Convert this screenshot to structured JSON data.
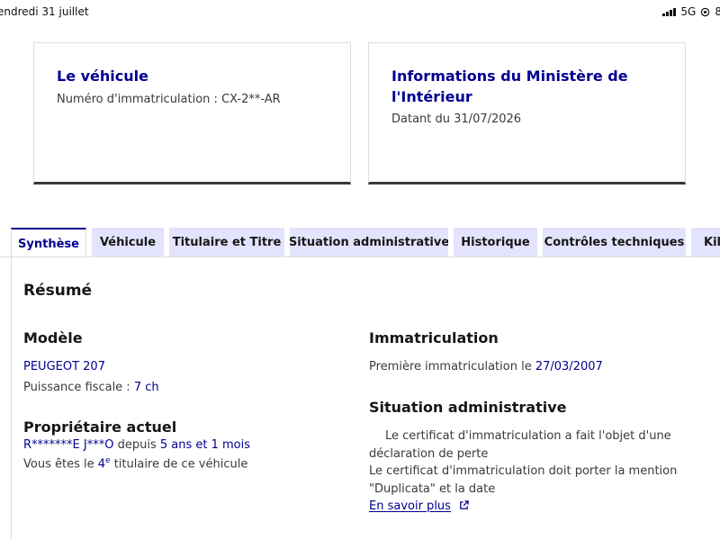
{
  "statusbar": {
    "date": "endredi 31 juillet",
    "network": "5G",
    "battery_fragment": "8"
  },
  "card_vehicle": {
    "title": "Le véhicule",
    "plate_label": "Numéro d'immatriculation : ",
    "plate_value": "CX-2**-AR"
  },
  "card_ministry": {
    "title": "Informations du Ministère de l'Intérieur",
    "date_label": "Datant du ",
    "date_value": "31/07/2026"
  },
  "tabs": [
    {
      "label": "Synthèse",
      "active": true
    },
    {
      "label": "Véhicule",
      "active": false
    },
    {
      "label": "Titulaire et Titre",
      "active": false
    },
    {
      "label": "Situation administrative",
      "active": false
    },
    {
      "label": "Historique",
      "active": false
    },
    {
      "label": "Contrôles techniques",
      "active": false
    },
    {
      "label": "Kilo",
      "active": false
    }
  ],
  "summary": {
    "title": "Résumé",
    "model": {
      "heading": "Modèle",
      "name": "PEUGEOT 207",
      "power_label": "Puissance fiscale : ",
      "power_value": "7 ch"
    },
    "owner": {
      "heading": "Propriétaire actuel",
      "name": "R*******E J***O",
      "since_label": " depuis ",
      "since_value": "5 ans et 1 mois",
      "rank_prefix": "Vous êtes le ",
      "rank_number": "4",
      "rank_sup": "e",
      "rank_suffix": " titulaire de ce véhicule"
    },
    "registration": {
      "heading": "Immatriculation",
      "first_label": "Première immatriculation le ",
      "first_value": "27/03/2007"
    },
    "admin": {
      "heading": "Situation administrative",
      "line1": "Le certificat d'immatriculation a fait l'objet d'une",
      "line2": "déclaration de perte",
      "line3": "Le certificat d'immatriculation doit porter la mention",
      "line4": "\"Duplicata\" et la date",
      "link": "En savoir plus"
    }
  },
  "colors": {
    "accent": "#000091",
    "tab_bg": "#e3e3fd",
    "text": "#3a3a3a"
  }
}
